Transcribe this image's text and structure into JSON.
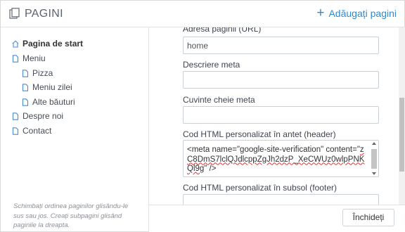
{
  "header": {
    "title": "PAGINI",
    "add_label": "Adăugați pagini"
  },
  "sidebar": {
    "items": [
      {
        "label": "Pagina de start"
      },
      {
        "label": "Meniu"
      },
      {
        "label": "Pizza"
      },
      {
        "label": "Meniu zilei"
      },
      {
        "label": "Alte băuturi"
      },
      {
        "label": "Despre noi"
      },
      {
        "label": "Contact"
      }
    ],
    "hint": "Schimbați ordinea paginilor glisându-le sus sau jos. Creați subpagini glisând paginile la dreapta."
  },
  "form": {
    "url_label": "Adresa paginii (URL)",
    "url_value": "home",
    "meta_desc_label": "Descriere meta",
    "meta_desc_value": "",
    "meta_keywords_label": "Cuvinte cheie meta",
    "meta_keywords_value": "",
    "header_html_label": "Cod HTML personalizat în antet (header)",
    "header_html_line1": "<meta name=\"google-site-verification\" content=\"",
    "header_html_token": "zC8DmS7lclQJdlcppZgJh2dzP_XeCWUz0wlpPNKQl9g",
    "header_html_line2": "\" />",
    "footer_html_label": "Cod HTML personalizat în subsol (footer)"
  },
  "footer": {
    "close_label": "Închideți"
  },
  "colors": {
    "accent": "#2a8ad4",
    "border": "#c8d0d8"
  }
}
